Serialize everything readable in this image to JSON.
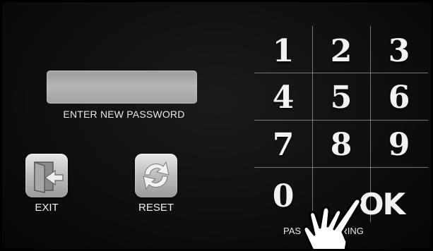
{
  "password": {
    "value": "",
    "label": "ENTER NEW PASSWORD"
  },
  "buttons": {
    "exit_label": "EXIT",
    "reset_label": "RESET"
  },
  "keypad": {
    "keys": [
      "1",
      "2",
      "3",
      "4",
      "5",
      "6",
      "7",
      "8",
      "9",
      "0"
    ],
    "ok_label": "OK"
  },
  "status": {
    "text": "PAS          ITERING"
  },
  "icons": {
    "exit": "exit-door-icon",
    "reset": "refresh-arrows-icon",
    "pointer": "pointing-hand-icon"
  }
}
